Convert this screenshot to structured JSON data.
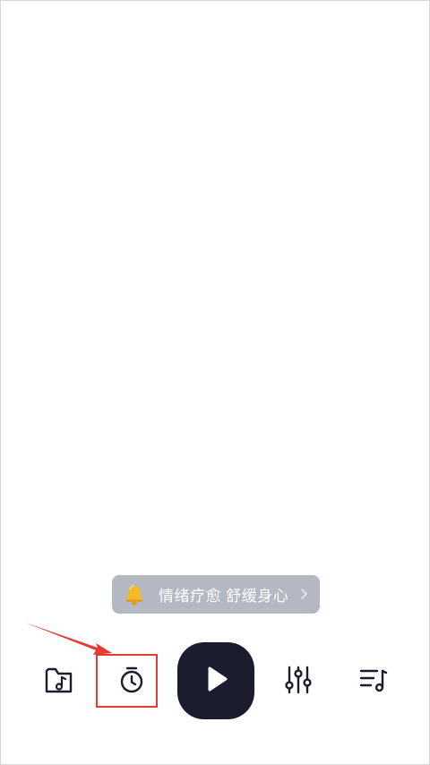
{
  "notice": {
    "text": "情绪疗愈 舒缓身心",
    "icon": "bell-icon",
    "chevron": "chevron-right-icon"
  },
  "toolbar": {
    "items": [
      {
        "icon": "music-folder-icon"
      },
      {
        "icon": "timer-icon",
        "highlighted": true
      },
      {
        "icon": "play-icon"
      },
      {
        "icon": "equalizer-icon"
      },
      {
        "icon": "playlist-icon"
      }
    ]
  },
  "colors": {
    "notice_bg": "#b4b8c2",
    "play_bg": "#1b1c2e",
    "annotation_red": "#e53b30",
    "icon_dark": "#1b1c2e"
  }
}
